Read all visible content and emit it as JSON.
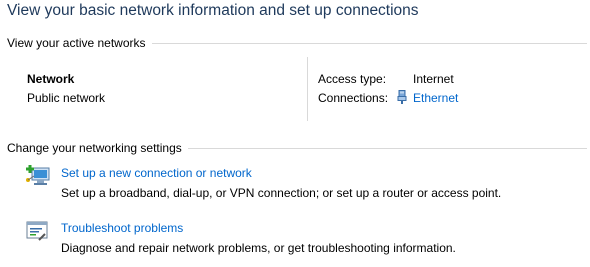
{
  "page": {
    "title": "View your basic network information and set up connections"
  },
  "active_networks": {
    "header": "View your active networks",
    "network": {
      "name": "Network",
      "category": "Public network",
      "access_type_label": "Access type:",
      "access_type_value": "Internet",
      "connections_label": "Connections:",
      "connection_name": "Ethernet",
      "connection_icon": "ethernet-adapter-icon"
    }
  },
  "networking_settings": {
    "header": "Change your networking settings",
    "tasks": [
      {
        "link": "Set up a new connection or network",
        "description": "Set up a broadband, dial-up, or VPN connection; or set up a router or access point.",
        "icon": "new-connection-icon"
      },
      {
        "link": "Troubleshoot problems",
        "description": "Diagnose and repair network problems, or get troubleshooting information.",
        "icon": "troubleshoot-icon"
      }
    ]
  },
  "colors": {
    "title": "#1e395b",
    "link": "#0066cc",
    "divider": "#d9d9d9"
  }
}
